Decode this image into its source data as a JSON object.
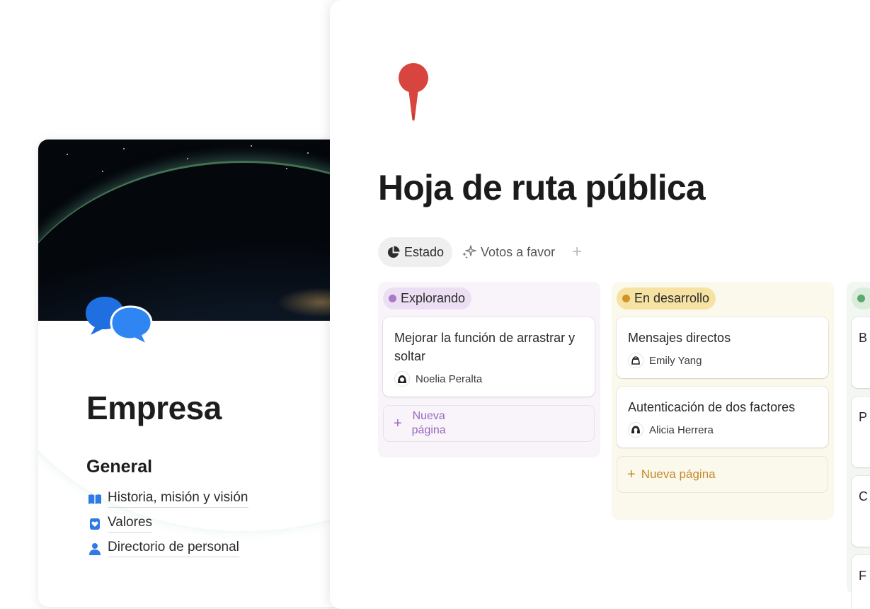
{
  "company": {
    "title": "Empresa",
    "section_title": "General",
    "links": [
      {
        "label": "Historia, misión y visión",
        "icon": "book-icon"
      },
      {
        "label": "Valores",
        "icon": "heart-badge-icon"
      },
      {
        "label": "Directorio de personal",
        "icon": "person-icon"
      }
    ],
    "cover_image": "earth-at-night",
    "page_icon": "speech-bubbles-icon"
  },
  "roadmap": {
    "title": "Hoja de ruta pública",
    "page_icon": "pushpin-icon",
    "tabs": [
      {
        "label": "Estado",
        "icon": "pie-chart-icon",
        "active": true
      },
      {
        "label": "Votos a favor",
        "icon": "sparkles-icon",
        "active": false
      }
    ],
    "add_view": "+",
    "columns": [
      {
        "status": "Explorando",
        "color": "#a87ac9",
        "cards": [
          {
            "title": "Mejorar la función de arrastrar y soltar",
            "assignee": "Noelia Peralta"
          }
        ],
        "new_page_label": "Nueva página"
      },
      {
        "status": "En desarrollo",
        "color": "#d09429",
        "cards": [
          {
            "title": "Mensajes directos",
            "assignee": "Emily Yang"
          },
          {
            "title": "Autenticación de dos factores",
            "assignee": "Alicia Herrera"
          }
        ],
        "new_page_label": "Nueva página"
      },
      {
        "status": "",
        "color": "#5aa86a",
        "cards": [
          {
            "title": "B"
          },
          {
            "title": "P"
          },
          {
            "title": "C"
          },
          {
            "title": "F"
          }
        ]
      }
    ]
  }
}
